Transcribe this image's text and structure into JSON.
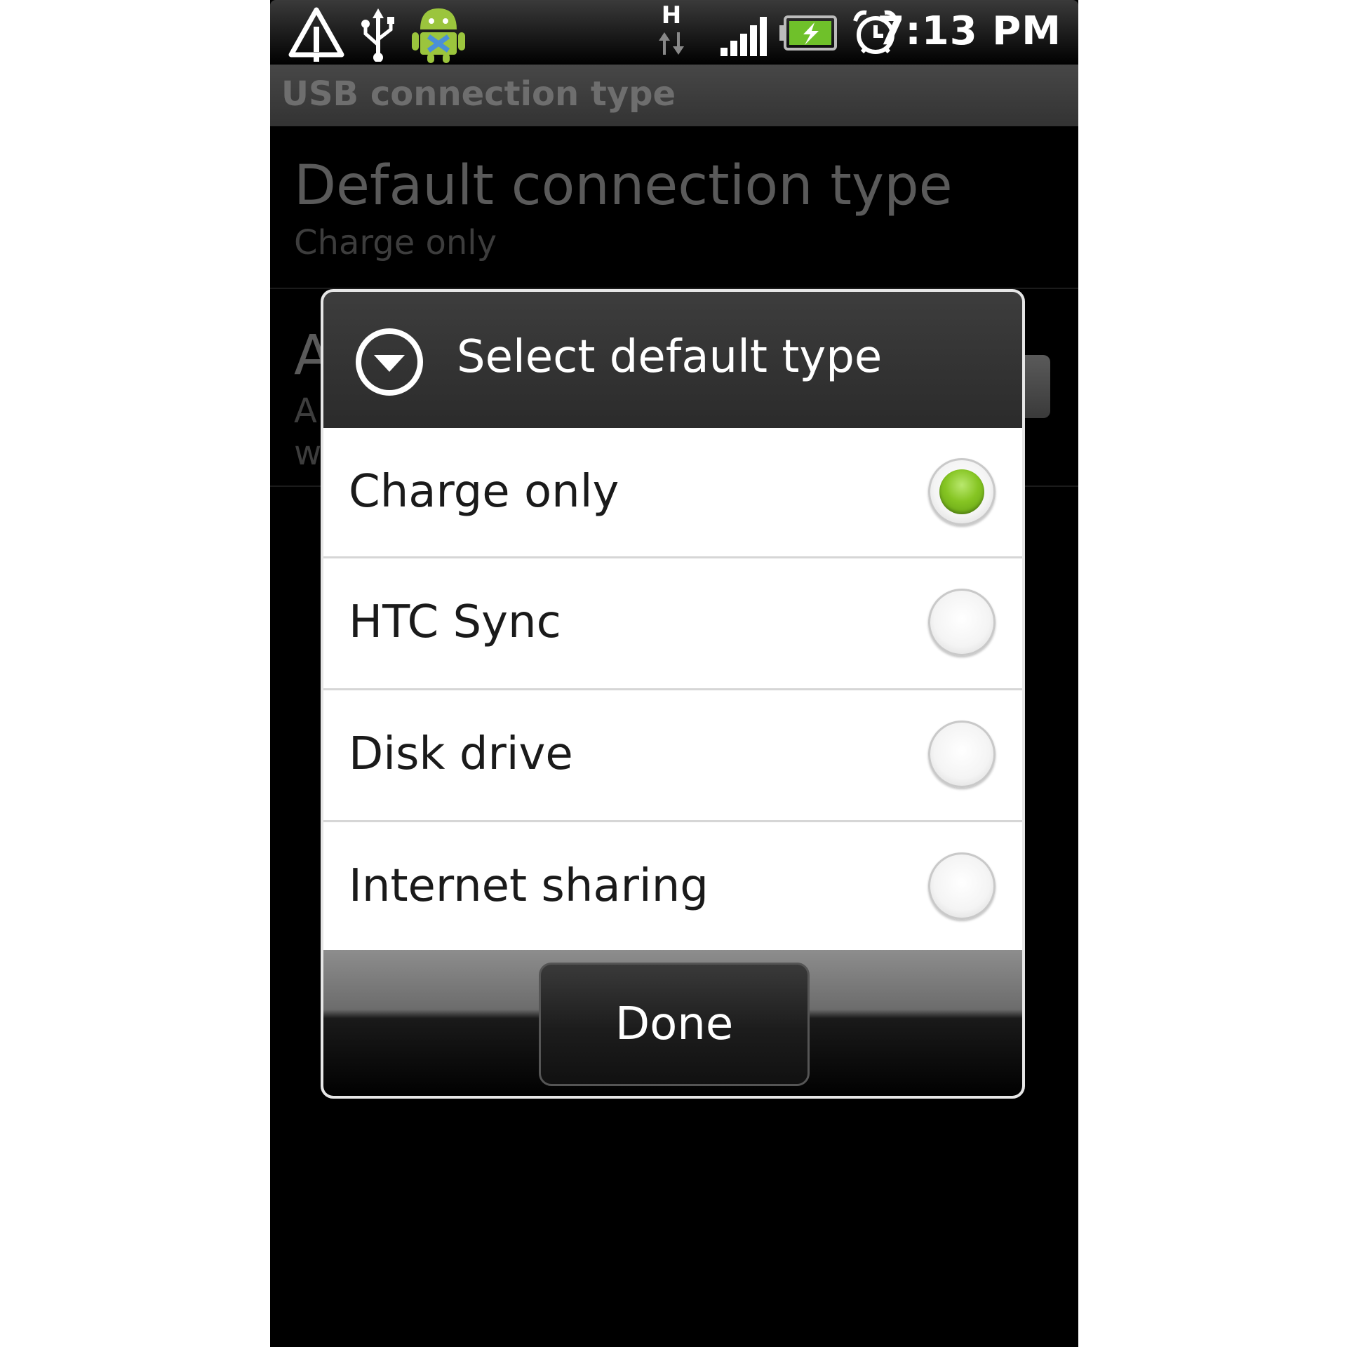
{
  "status_bar": {
    "time": "7:13 PM",
    "network_type": "H",
    "icons": [
      "warning-icon",
      "usb-icon",
      "android-debug-icon",
      "network-activity-icon",
      "signal-icon",
      "battery-charging-icon",
      "alarm-icon"
    ]
  },
  "header": {
    "title": "USB connection type"
  },
  "background_list": {
    "items": [
      {
        "title": "Default connection type",
        "summary": "Charge only"
      },
      {
        "title": "A",
        "summary": "A\nw"
      }
    ]
  },
  "dialog": {
    "title": "Select default type",
    "options": [
      {
        "label": "Charge only",
        "selected": true
      },
      {
        "label": "HTC Sync",
        "selected": false
      },
      {
        "label": "Disk drive",
        "selected": false
      },
      {
        "label": "Internet sharing",
        "selected": false
      }
    ],
    "done_label": "Done"
  },
  "colors": {
    "accent_green": "#86c523",
    "dialog_header": "#333333",
    "background": "#000000"
  }
}
